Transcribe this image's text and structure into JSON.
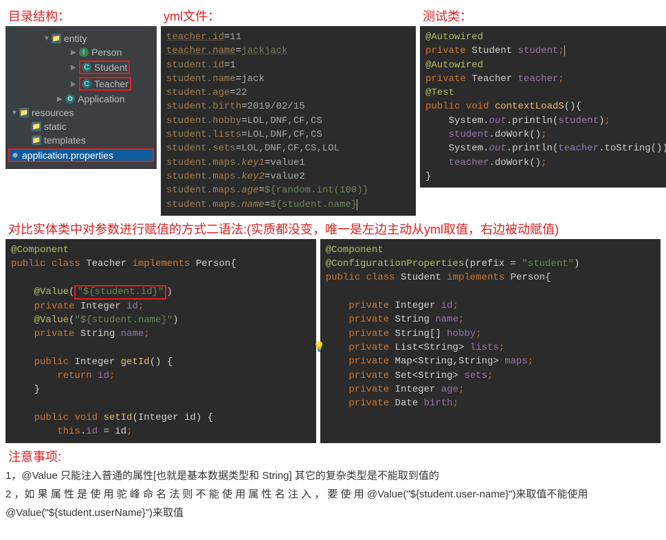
{
  "headings": {
    "dir": "目录结构：",
    "yml": "yml文件：",
    "test": "测试类：",
    "compare_prefix": "对比实体类中对参数进行赋值的方式二语法:",
    "compare_detail": "(实质都没变，唯一是左边主动从yml取值，右边被动赋值)",
    "notice": "注意事项:"
  },
  "tree": {
    "entity": "entity",
    "person": "Person",
    "student": "Student",
    "teacher": "Teacher",
    "application": "Application",
    "resources": "resources",
    "static": "static",
    "templates": "templates",
    "props": "application.properties"
  },
  "yml": {
    "l1_k": "teacher.id",
    "l1_v": "11",
    "l2_k": "teacher.name",
    "l2_v": "jackjack",
    "l3_k": "student.id",
    "l3_v": "1",
    "l4_k": "student.name",
    "l4_v": "jack",
    "l5_k": "student.age",
    "l5_v": "22",
    "l6_k": "student.birth",
    "l6_v": "2019/02/15",
    "l7_k": "student.hobby",
    "l7_v": "LOL,DNF,CF,CS",
    "l8_k": "student.lists",
    "l8_v": "LOL,DNF,CF,CS",
    "l9_k": "student.sets",
    "l9_v": "LOL,DNF,CF,CS,LOL",
    "l10_k": "student.maps.",
    "l10_p": "key1",
    "l10_v": "value1",
    "l11_k": "student.maps.",
    "l11_p": "key2",
    "l11_v": "value2",
    "l12_k": "student.maps.",
    "l12_p": "age",
    "l12_v": "${random.int(100)}",
    "l13_k": "student.maps.",
    "l13_p": "name",
    "l13_v": "${student.name}"
  },
  "test": {
    "autowired": "@Autowired",
    "priv": "private",
    "student_t": "Student",
    "student_f": "student",
    "teacher_t": "Teacher",
    "teacher_f": "teacher",
    "test_ann": "@Test",
    "public": "public",
    "void": "void",
    "method": "contextLoadS",
    "sys": "System",
    "out": "out",
    "println": "println",
    "dowork": "doWork",
    "tostring": "toString"
  },
  "teacher_class": {
    "component": "@Component",
    "public": "public",
    "class": "class",
    "name": "Teacher",
    "implements": "implements",
    "person": "Person",
    "value1": "@Value",
    "val1_str": "\"${student.id}\"",
    "priv": "private",
    "integer": "Integer",
    "id": "id",
    "value2": "@Value",
    "val2_str": "\"${student.name}\"",
    "string": "String",
    "name_f": "name",
    "getid": "getId",
    "return": "return",
    "setid": "setId",
    "void": "void",
    "this": "this"
  },
  "student_class": {
    "component": "@Component",
    "config": "@ConfigurationProperties",
    "prefix": "prefix",
    "prefix_val": "\"student\"",
    "public": "public",
    "class": "class",
    "name": "Student",
    "implements": "implements",
    "person": "Person",
    "priv": "private",
    "integer": "Integer",
    "id": "id",
    "string": "String",
    "name_f": "name",
    "stringarr": "String[]",
    "hobby": "hobby",
    "list": "List<String>",
    "lists": "lists",
    "map": "Map<String,String>",
    "maps": "maps",
    "set": "Set<String>",
    "sets": "sets",
    "age": "age",
    "date": "Date",
    "birth": "birth"
  },
  "notes": {
    "n1": "1，@Value 只能注入普通的属性[也就是基本数据类型和 String] 其它的复杂类型是不能取到值的",
    "n2": "2 ，如 果 属 性 是 使 用 驼 峰 命 名 法 则 不 能 使 用 属 性 名 注 入 ， 要 使 用 @Value(\"${student.user-name}\")来取值不能使用@Value(\"${student.userName}\")来取值"
  }
}
